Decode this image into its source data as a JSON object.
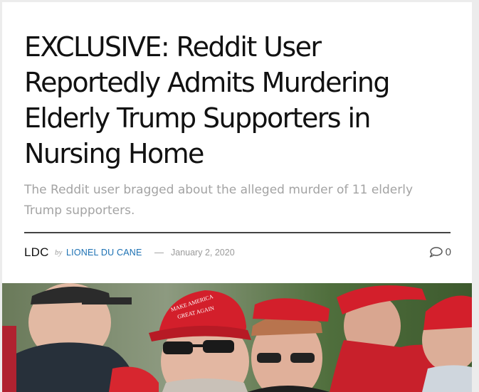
{
  "article": {
    "title": "EXCLUSIVE: Reddit User Reportedly Admits Murdering Elderly Trump Supporters in Nursing Home",
    "subtitle": "The Reddit user bragged about the alleged murder of 11 elderly Trump supporters.",
    "author_avatar_text": "LDC",
    "by_label": "by",
    "author_name": "LIONEL DU CANE",
    "separator": "—",
    "date": "January 2, 2020",
    "comment_count": "0",
    "comment_icon": "speech-bubble-icon"
  },
  "photo": {
    "hat_text_1": "MAKE AMERICA",
    "hat_text_2": "GREAT AGAIN",
    "colors": {
      "hat_red": "#d31f2b",
      "background_green": "#4d6a3a"
    }
  }
}
